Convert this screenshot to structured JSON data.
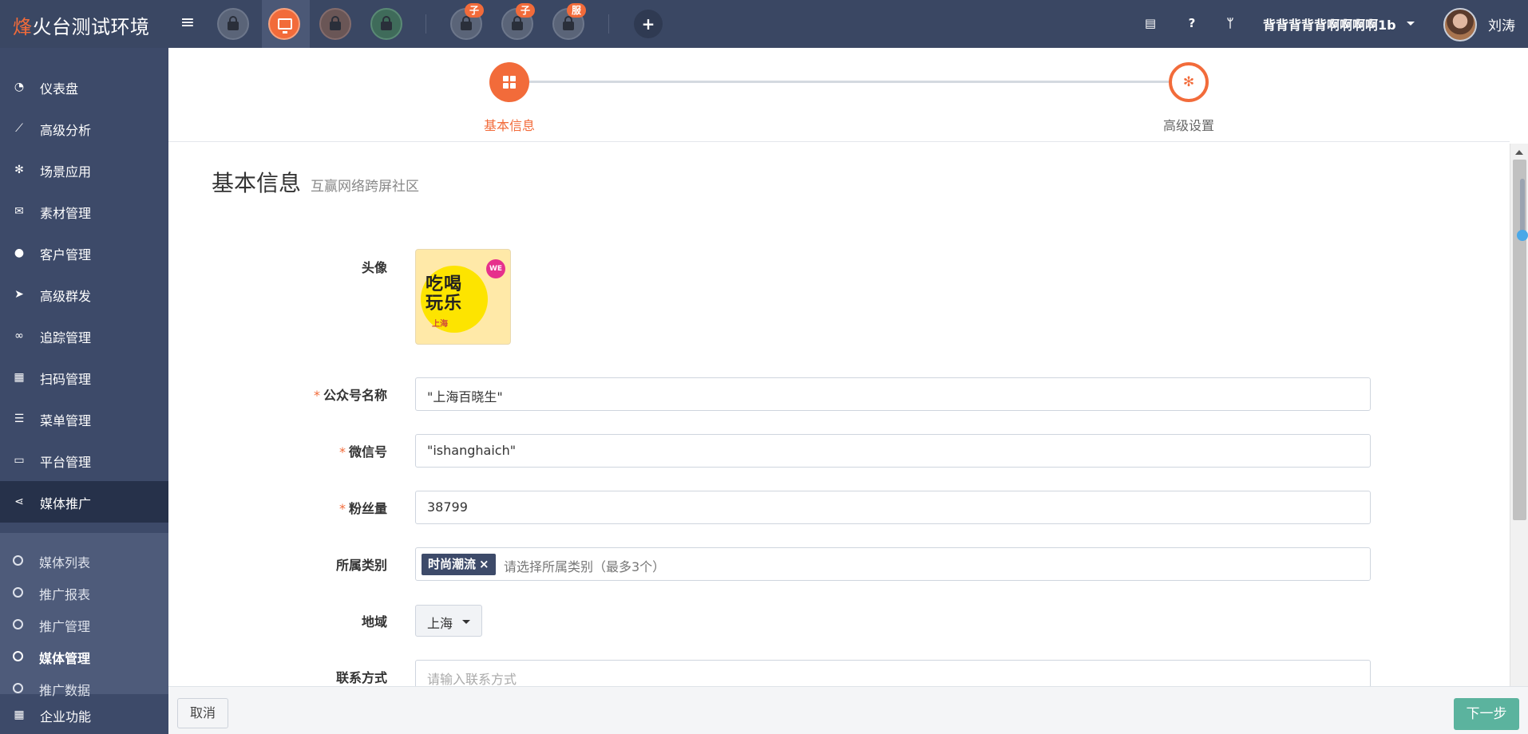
{
  "header": {
    "brand_prefix": "烽",
    "brand_rest": "火台测试环境",
    "menu_icon": "hamburger-icon",
    "apps": [
      {
        "icon": "lock-icon",
        "badge": ""
      },
      {
        "icon": "screen-share-icon",
        "badge": ""
      },
      {
        "icon": "lock-icon",
        "badge": ""
      },
      {
        "icon": "lock-icon",
        "badge": ""
      },
      {
        "icon": "lock-icon",
        "badge": "子"
      },
      {
        "icon": "lock-icon",
        "badge": "子"
      },
      {
        "icon": "lock-icon",
        "badge": "服"
      }
    ],
    "add_icon": "plus-icon",
    "tools": [
      "book-icon",
      "help-icon",
      "branch-icon"
    ],
    "org_name": "背背背背背啊啊啊啊1b",
    "username": "刘涛"
  },
  "sidebar": {
    "items": [
      {
        "label": "仪表盘",
        "icon": "dashboard-icon"
      },
      {
        "label": "高级分析",
        "icon": "line-chart-icon"
      },
      {
        "label": "场景应用",
        "icon": "gear-icon"
      },
      {
        "label": "素材管理",
        "icon": "envelope-icon"
      },
      {
        "label": "客户管理",
        "icon": "user-icon"
      },
      {
        "label": "高级群发",
        "icon": "send-icon"
      },
      {
        "label": "追踪管理",
        "icon": "link-icon"
      },
      {
        "label": "扫码管理",
        "icon": "qrcode-icon"
      },
      {
        "label": "菜单管理",
        "icon": "list-icon"
      },
      {
        "label": "平台管理",
        "icon": "monitor-icon"
      },
      {
        "label": "媒体推广",
        "icon": "share-icon"
      }
    ],
    "submenu": [
      {
        "label": "媒体列表"
      },
      {
        "label": "推广报表"
      },
      {
        "label": "推广管理"
      },
      {
        "label": "媒体管理"
      },
      {
        "label": "推广数据"
      }
    ],
    "bottom_item": {
      "label": "企业功能",
      "icon": "grid-icon"
    }
  },
  "steps": [
    {
      "label": "基本信息",
      "icon": "grid-icon"
    },
    {
      "label": "高级设置",
      "icon": "gear-icon"
    }
  ],
  "section": {
    "title": "基本信息",
    "subtitle": "互赢网络跨屏社区"
  },
  "form": {
    "avatar_label": "头像",
    "logo": {
      "line1": "吃喝",
      "line2": "玩乐",
      "sub": "上海",
      "badge": "WE"
    },
    "name_label": "公众号名称",
    "name_value": "\"上海百晓生\"",
    "wechat_label": "微信号",
    "wechat_value": "\"ishanghaich\"",
    "fans_label": "粉丝量",
    "fans_value": "38799",
    "category_label": "所属类别",
    "category_tag": "时尚潮流",
    "category_tag_close": "×",
    "category_placeholder": "请选择所属类别（最多3个）",
    "region_label": "地域",
    "region_value": "上海",
    "contact_label": "联系方式",
    "contact_placeholder": "请输入联系方式"
  },
  "footer": {
    "cancel_label": "取消",
    "next_label": "下一步"
  },
  "colors": {
    "accent": "#f26b3a",
    "sidebar_bg": "#3d4a69",
    "header_bg": "#3a4763",
    "next_button": "#5bb39e"
  }
}
